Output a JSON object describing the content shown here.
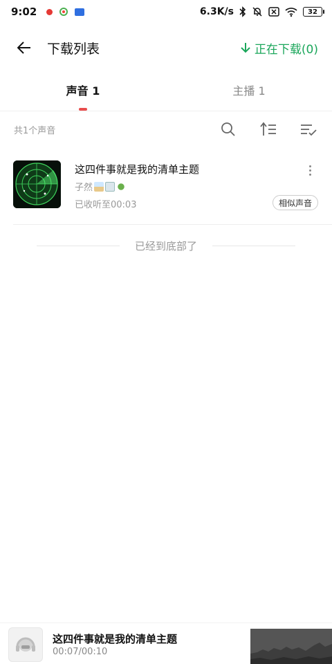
{
  "status_bar": {
    "time": "9:02",
    "network_speed": "6.3K/s",
    "battery": "32"
  },
  "header": {
    "title": "下载列表",
    "downloading_label": "正在下载(0)",
    "accent_color": "#1aa65a"
  },
  "tabs": [
    {
      "label": "声音 1",
      "active": true
    },
    {
      "label": "主播 1",
      "active": false
    }
  ],
  "toolbar": {
    "count_text": "共1个声音",
    "icons": [
      "search-icon",
      "sort-icon",
      "batch-edit-icon"
    ]
  },
  "tracks": [
    {
      "title": "这四件事就是我的清单主题",
      "author": "子然",
      "progress": "已收听至00:03",
      "similar_label": "相似声音"
    }
  ],
  "end_text": "已经到底部了",
  "player": {
    "title": "这四件事就是我的清单主题",
    "time": "00:07/00:10"
  },
  "colors": {
    "tab_indicator": "#e84d4d"
  }
}
